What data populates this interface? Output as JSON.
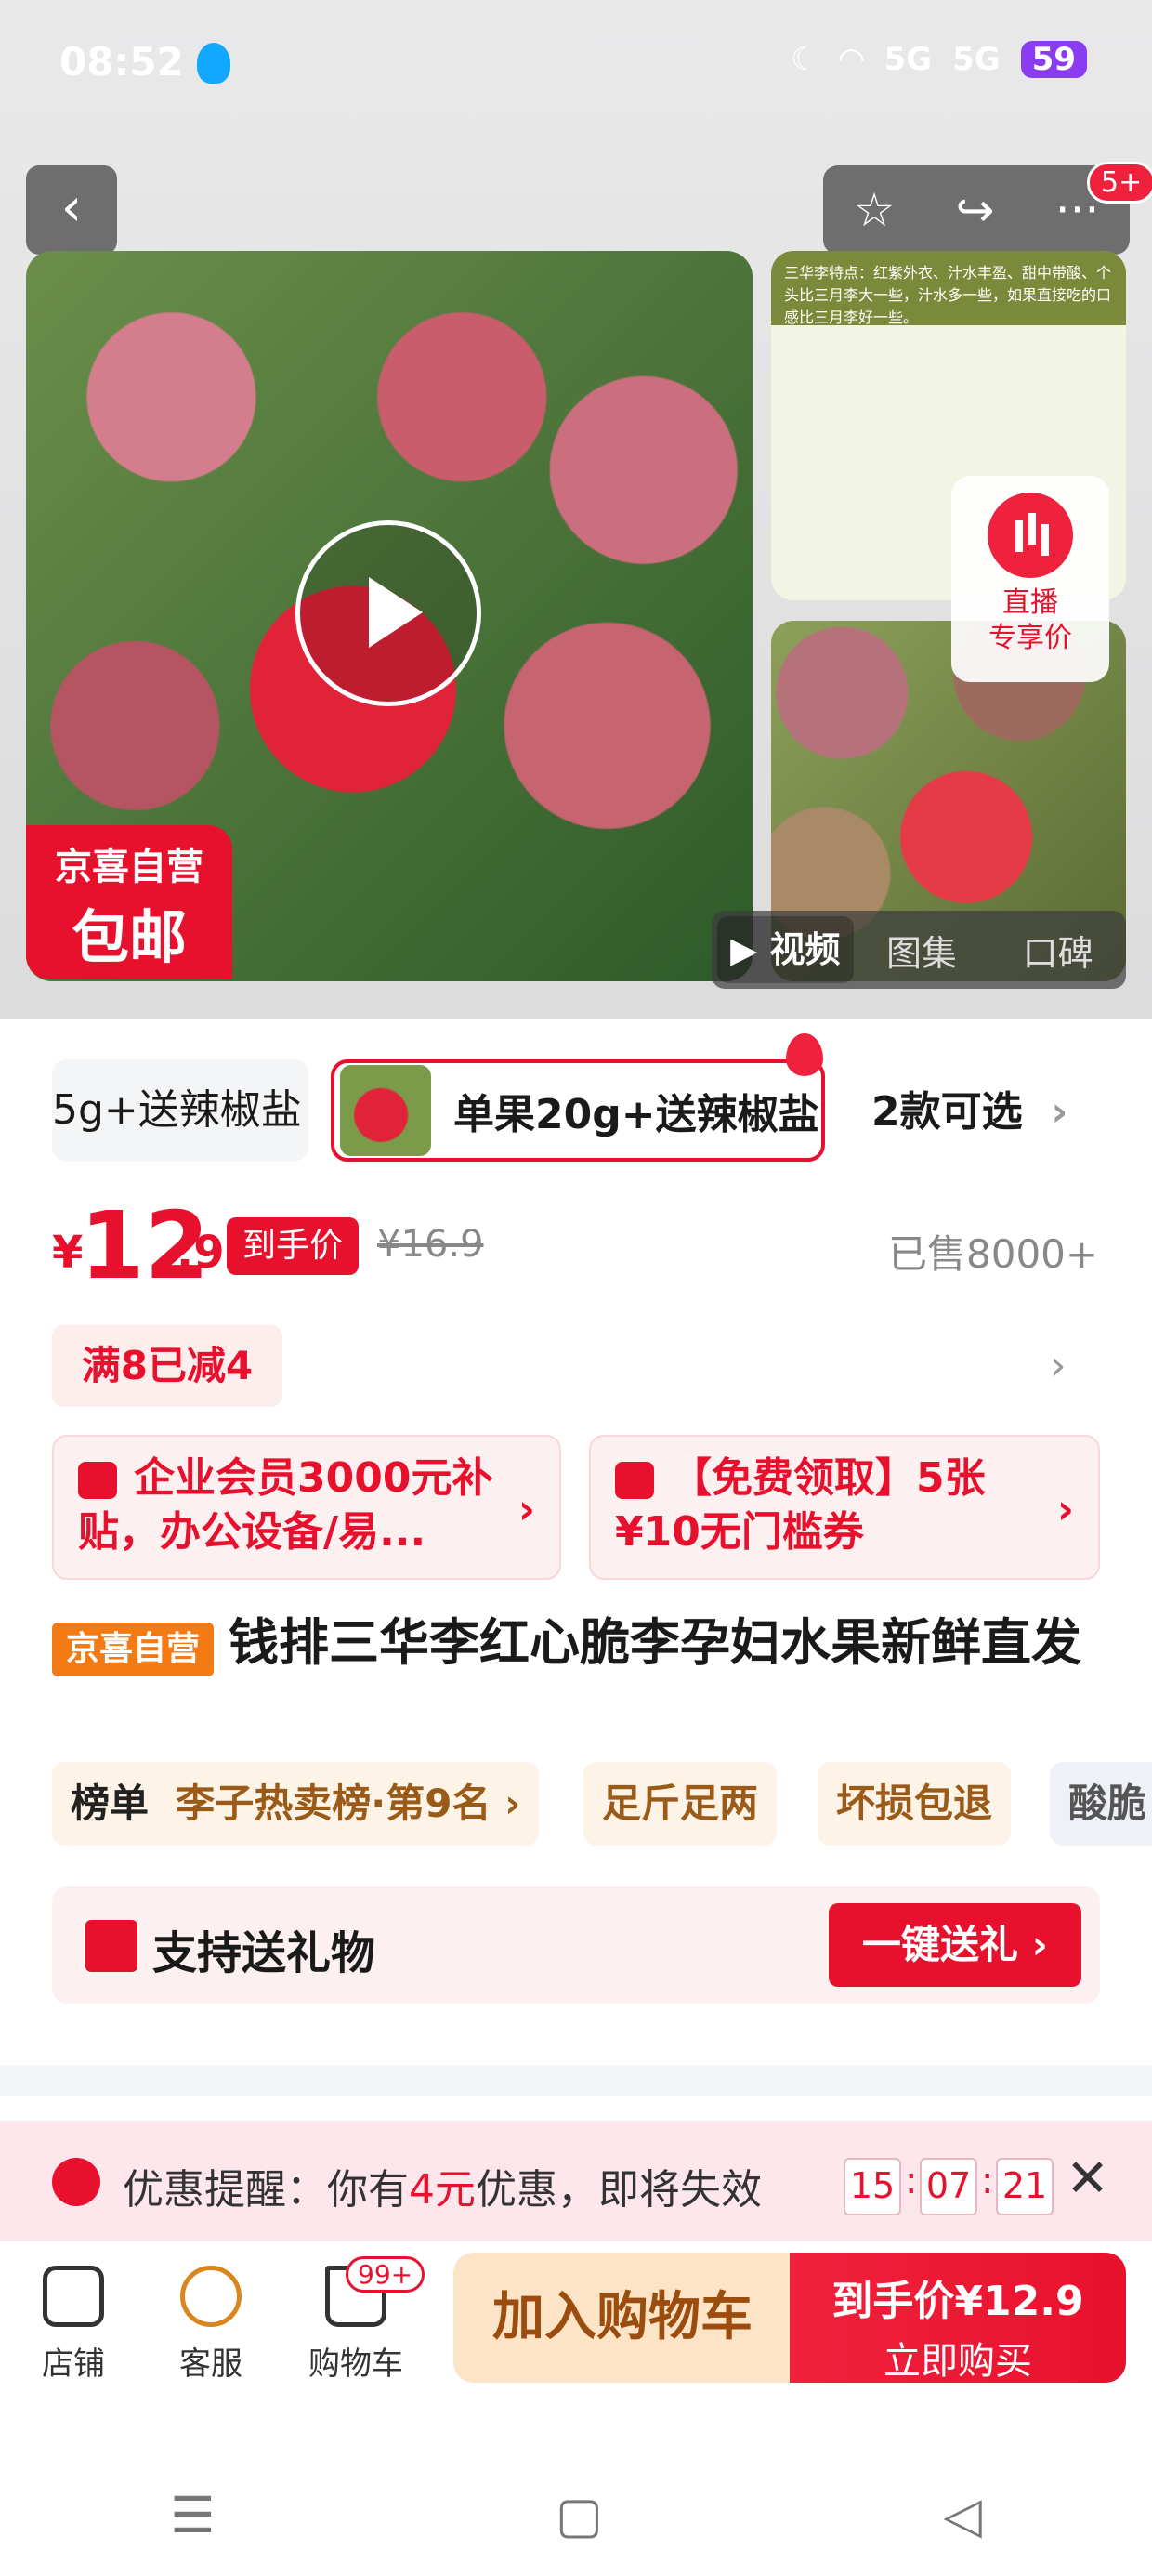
{
  "status_bar": {
    "time": "08:52",
    "signal_1": "5G",
    "signal_2": "5G",
    "battery": "59"
  },
  "header": {
    "back_glyph": "‹",
    "star_glyph": "☆",
    "share_glyph": "↪",
    "more_glyph": "···",
    "badge": "5+"
  },
  "media": {
    "promo_tag_line1": "京喜自营",
    "promo_tag_line2": "包邮",
    "side_image_text": "三华李特点：红紫外衣、汁水丰盈、甜中带酸、个头比三月李大一些，汁水多一些，如果直接吃的口感比三月李好一些。",
    "live": {
      "line1": "直播",
      "line2": "专享价"
    },
    "tabs": [
      "视频",
      "图集",
      "口碑"
    ],
    "active_tab": "视频"
  },
  "sku": {
    "option_left": "5g+送辣椒盐",
    "option_selected": "单果20g+送辣椒盐",
    "count_label": "2款可选",
    "chevron": "›"
  },
  "price": {
    "symbol": "¥",
    "integer": "12",
    "decimal": ".9",
    "tag": "到手价",
    "original": "¥16.9",
    "sold": "已售8000+"
  },
  "promo": {
    "label": "满8已减4"
  },
  "coupons": [
    {
      "text": "企业会员3000元补贴，办公设备/易..."
    },
    {
      "text": "【免费领取】5张¥10无门槛券"
    }
  ],
  "product": {
    "shop_tag": "京喜自营",
    "title": "钱排三华李红心脆李孕妇水果新鲜直发",
    "rank_key": "榜单",
    "rank_value": "李子热卖榜·第9名 ›",
    "chips": [
      "足斤足两",
      "坏损包退",
      "酸脆"
    ]
  },
  "gift": {
    "label": "支持送礼物",
    "button": "一键送礼 ›"
  },
  "reminder": {
    "prefix": "优惠提醒：你有",
    "amount": "4元",
    "suffix": "优惠，即将失效",
    "timer": [
      "15",
      "07",
      "21"
    ],
    "close": "✕"
  },
  "bottom_bar": {
    "shop": "店铺",
    "service": "客服",
    "cart": "购物车",
    "cart_badge": "99+",
    "add_to_cart": "加入购物车",
    "buy_price": "到手价¥12.9",
    "buy_now": "立即购买"
  },
  "nav": {
    "menu": "☰",
    "home": "▢",
    "back": "◁"
  },
  "colors": {
    "accent": "#e8112d",
    "tag_orange": "#f47a13"
  }
}
